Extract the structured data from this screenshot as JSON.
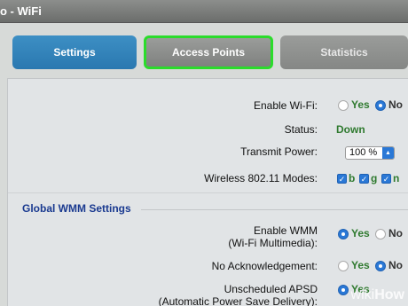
{
  "window": {
    "title": "o - WiFi"
  },
  "tabs": [
    {
      "label": "Settings",
      "state": "inactive"
    },
    {
      "label": "Access Points",
      "state": "highlighted"
    },
    {
      "label": "Statistics",
      "state": "disabled"
    }
  ],
  "settings": {
    "enable_wifi": {
      "label": "Enable Wi-Fi:",
      "yes": "Yes",
      "no": "No",
      "selected": "No"
    },
    "status": {
      "label": "Status:",
      "value": "Down"
    },
    "transmit_power": {
      "label": "Transmit Power:",
      "value": "100 %"
    },
    "wireless_modes": {
      "label": "Wireless 802.11 Modes:",
      "options": [
        "b",
        "g",
        "n"
      ],
      "checked": [
        "b",
        "g",
        "n"
      ]
    }
  },
  "wmm": {
    "section_title": "Global WMM Settings",
    "enable_wmm": {
      "label_line1": "Enable WMM",
      "label_line2": "(Wi-Fi Multimedia):",
      "yes": "Yes",
      "no": "No",
      "selected": "Yes"
    },
    "no_ack": {
      "label": "No Acknowledgement:",
      "yes": "Yes",
      "no": "No",
      "selected": "No"
    },
    "apsd": {
      "label_line1": "Unscheduled APSD",
      "label_line2": "(Automatic Power Save Delivery):",
      "yes": "Yes",
      "selected": "Yes"
    }
  },
  "colors": {
    "accent_blue": "#2a78d6",
    "highlight_green": "#2bdc2b",
    "value_green": "#2f7a2f",
    "section_blue": "#1a3a90"
  },
  "watermark": {
    "prefix": "wiki",
    "suffix": "How"
  }
}
